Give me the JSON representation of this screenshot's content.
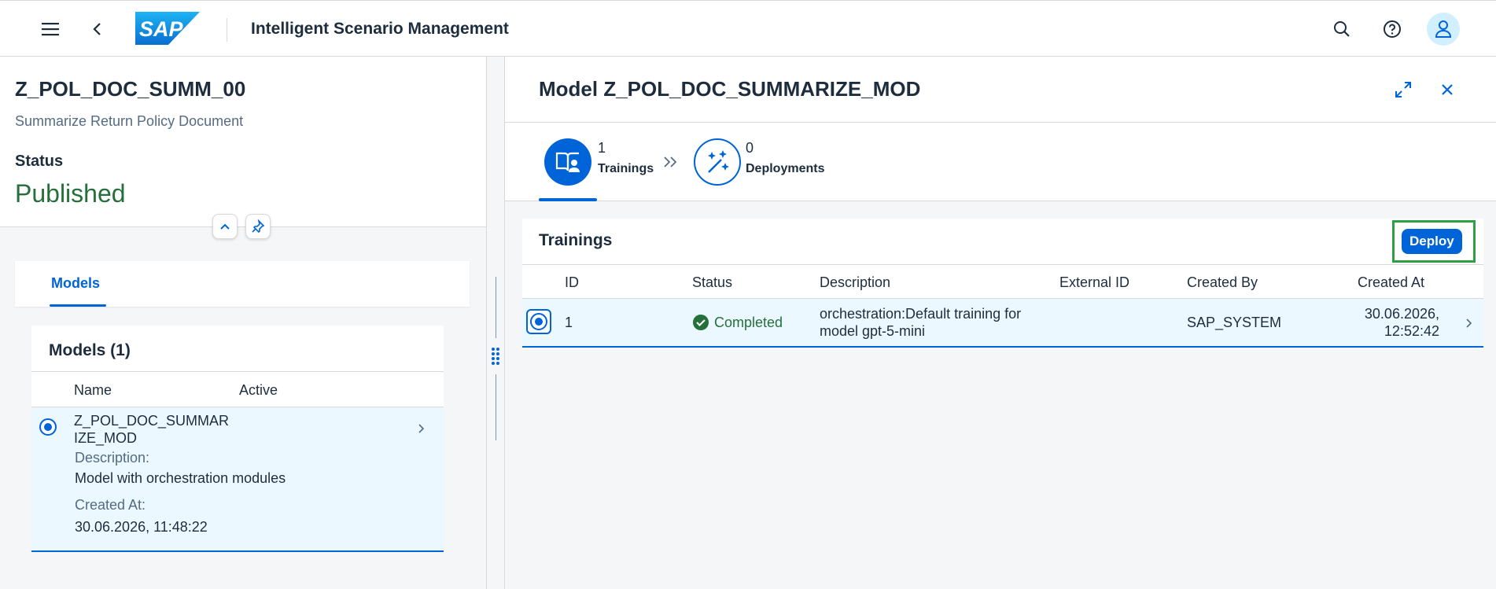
{
  "shell": {
    "title": "Intelligent Scenario Management",
    "logo_text": "SAP",
    "icons": [
      "menu-icon",
      "back-icon",
      "search-icon",
      "help-icon",
      "user-icon"
    ]
  },
  "object": {
    "title": "Z_POL_DOC_SUMM_00",
    "subtitle": "Summarize Return Policy Document",
    "status_label": "Status",
    "status_value": "Published"
  },
  "tabs": [
    {
      "label": "Models",
      "selected": true
    }
  ],
  "models": {
    "title": "Models (1)",
    "columns": [
      "Name",
      "Active"
    ],
    "rows": [
      {
        "name": "Z_POL_DOC_SUMMARIZE_MOD",
        "description_label": "Description:",
        "description": "Model with orchestration modules",
        "created_at_label": "Created At:",
        "created_at": "30.06.2026, 11:48:22",
        "selected": true
      }
    ]
  },
  "detail": {
    "title": "Model Z_POL_DOC_SUMMARIZE_MOD",
    "steps": [
      {
        "count": "1",
        "label": "Trainings",
        "active": true
      },
      {
        "count": "0",
        "label": "Deployments",
        "active": false
      }
    ],
    "trainings": {
      "title": "Trainings",
      "deploy_label": "Deploy",
      "columns": [
        "ID",
        "Status",
        "Description",
        "External ID",
        "Created By",
        "Created At"
      ],
      "rows": [
        {
          "id": "1",
          "status": "Completed",
          "description_line1": "orchestration:Default training for",
          "description_line2": "model gpt-5-mini",
          "external_id": "",
          "created_by": "SAP_SYSTEM",
          "created_at_line1": "30.06.2026,",
          "created_at_line2": "12:52:42"
        }
      ]
    }
  },
  "colors": {
    "accent": "#0064d9",
    "success": "#256f3a",
    "highlight_frame": "#2ea043",
    "selected_row": "#ebf8ff"
  }
}
